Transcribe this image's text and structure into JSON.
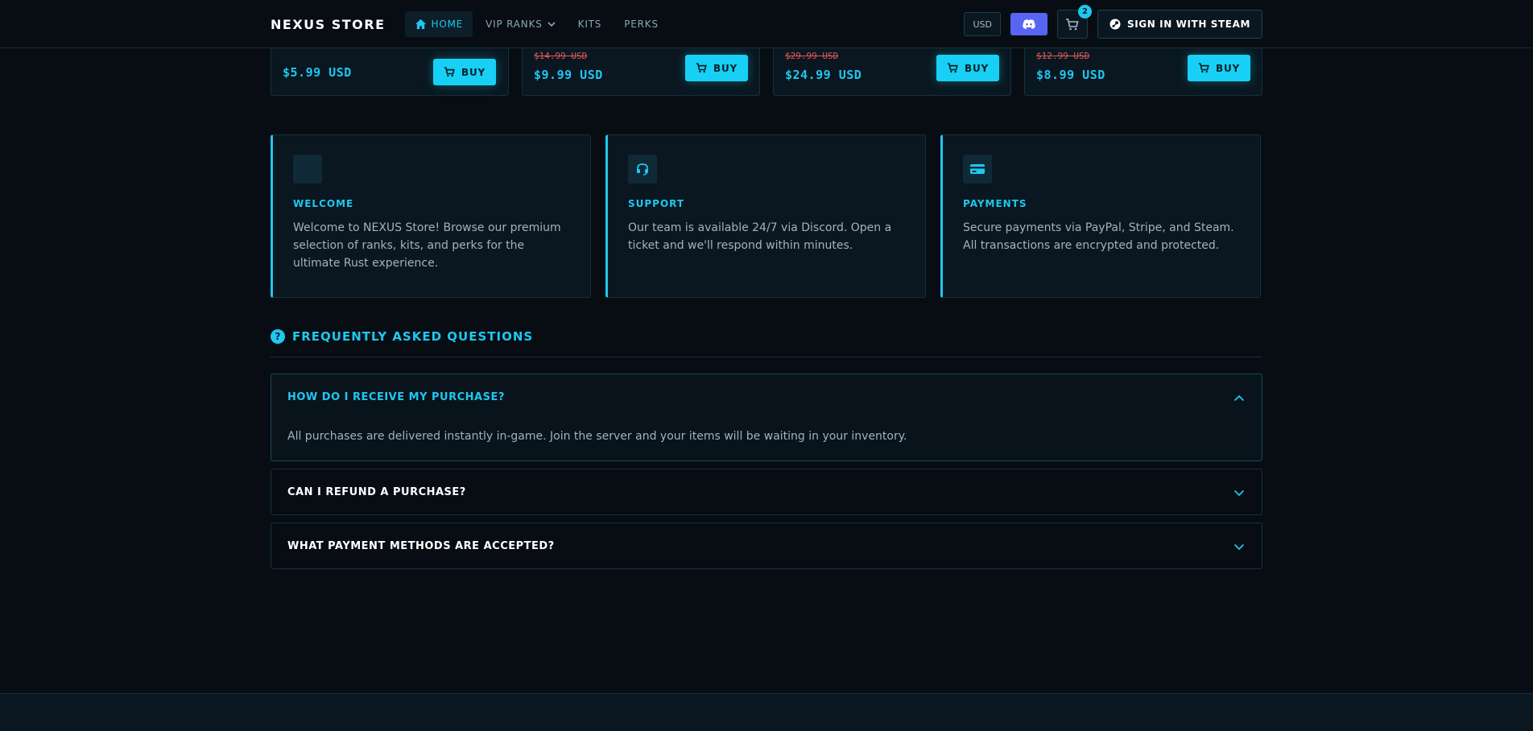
{
  "navbar": {
    "brand": "NEXUS STORE",
    "links": [
      {
        "label": "HOME",
        "icon": "home-icon",
        "active": true
      },
      {
        "label": "VIP RANKS",
        "dropdown": true
      },
      {
        "label": "KITS"
      },
      {
        "label": "PERKS"
      }
    ],
    "currency": "USD",
    "cart_count": "2",
    "sign_in_label": "SIGN IN WITH STEAM"
  },
  "products": [
    {
      "old_price": "",
      "price": "$5.99 USD",
      "buy_label": "BUY"
    },
    {
      "old_price": "$14.99 USD",
      "price": "$9.99 USD",
      "buy_label": "BUY"
    },
    {
      "old_price": "$29.99 USD",
      "price": "$24.99 USD",
      "buy_label": "BUY"
    },
    {
      "old_price": "$12.99 USD",
      "price": "$8.99 USD",
      "buy_label": "BUY"
    }
  ],
  "info_cards": [
    {
      "title": "WELCOME",
      "icon": "blank-icon",
      "text": "Welcome to NEXUS Store! Browse our premium selection of ranks, kits, and perks for the ultimate Rust experience."
    },
    {
      "title": "SUPPORT",
      "icon": "headset-icon",
      "text": "Our team is available 24/7 via Discord. Open a ticket and we'll respond within minutes."
    },
    {
      "title": "PAYMENTS",
      "icon": "credit-card-icon",
      "text": "Secure payments via PayPal, Stripe, and Steam. All transactions are encrypted and protected."
    }
  ],
  "faq": {
    "heading": "FREQUENTLY ASKED QUESTIONS",
    "items": [
      {
        "question": "HOW DO I RECEIVE MY PURCHASE?",
        "answer": "All purchases are delivered instantly in-game. Join the server and your items will be waiting in your inventory.",
        "open": true
      },
      {
        "question": "CAN I REFUND A PURCHASE?",
        "answer": "",
        "open": false
      },
      {
        "question": "WHAT PAYMENT METHODS ARE ACCEPTED?",
        "answer": "",
        "open": false
      }
    ]
  },
  "colors": {
    "accent": "#1ec8f0",
    "background": "#070d13",
    "card": "#0a1720",
    "discord": "#5865f2",
    "strike": "#e0585a"
  }
}
